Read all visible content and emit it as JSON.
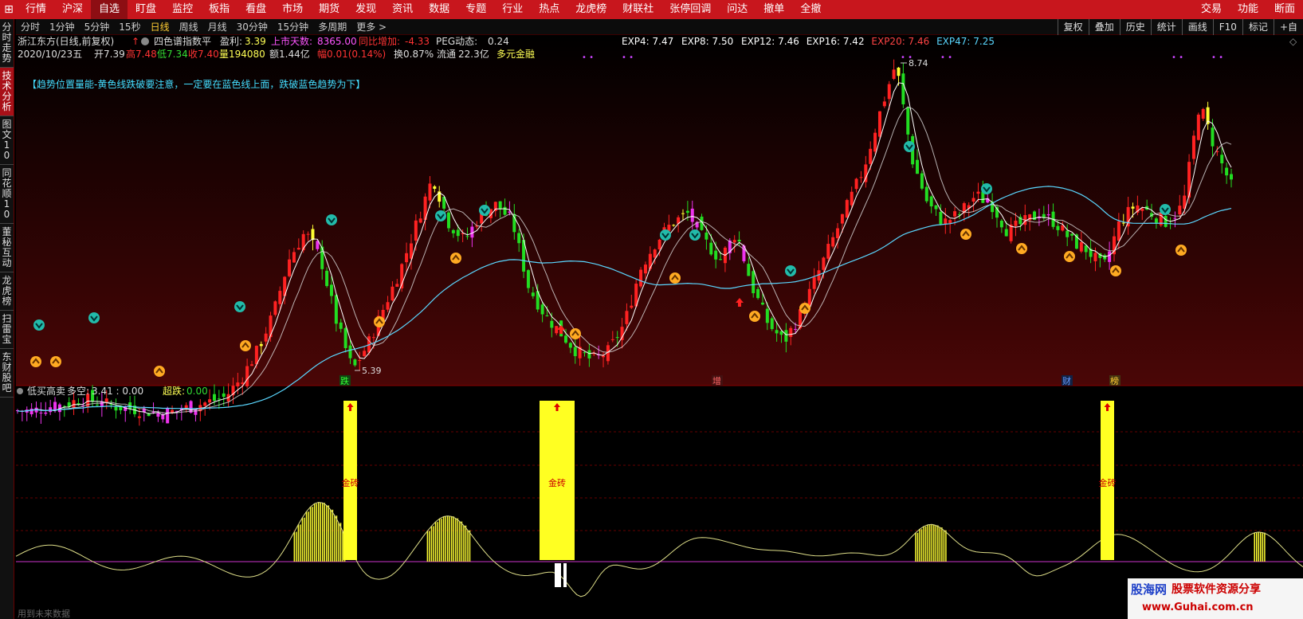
{
  "menu": {
    "items": [
      "行情",
      "沪深",
      "自选",
      "盯盘",
      "监控",
      "板指",
      "看盘",
      "市场",
      "期货",
      "发现",
      "资讯",
      "数据",
      "专题",
      "行业",
      "热点",
      "龙虎榜",
      "财联社",
      "张停回调",
      "问达",
      "撤单",
      "全撤"
    ],
    "right": [
      "交易",
      "功能",
      "断面"
    ]
  },
  "period": {
    "items": [
      "分时",
      "1分钟",
      "5分钟",
      "15秒",
      "日线",
      "周线",
      "月线",
      "30分钟",
      "15分钟",
      "多周期",
      "更多 >"
    ],
    "active": "日线",
    "tools": [
      "复权",
      "叠加",
      "历史",
      "统计",
      "画线",
      "F10",
      "标记",
      "+自"
    ]
  },
  "sidebar": [
    "分时走势",
    "技术分析",
    "图文10",
    "同花顺10",
    "董秘互动",
    "龙虎榜",
    "扫雷宝",
    "东财股吧"
  ],
  "header": {
    "stock": "浙江东方(日线,前复权)",
    "indicator": "四色谱指数平",
    "profit_label": "盈利:",
    "profit": "3.39",
    "days_label": "上市天数:",
    "days": "8365.00",
    "yoy_label": "同比增加:",
    "yoy": "-4.33",
    "peg_label": "PEG动态:",
    "peg": "0.24",
    "date": "2020/10/23五",
    "open_label": "开",
    "open": "7.39",
    "high_label": "高",
    "high": "7.48",
    "low_label": "低",
    "low": "7.34",
    "close_label": "收",
    "close": "7.40",
    "vol_label": "量",
    "vol": "194080",
    "amt_label": "额",
    "amt": "1.44亿",
    "chg_label": "幅",
    "chg": "0.01(0.14%)",
    "turn_label": "换",
    "turn": "0.87%",
    "float_label": "流通",
    "float": "22.3亿",
    "tag": "多元金融"
  },
  "exp": [
    {
      "name": "EXP4",
      "value": "7.47",
      "color": "#ffffff"
    },
    {
      "name": "EXP8",
      "value": "7.50",
      "color": "#ffffff"
    },
    {
      "name": "EXP12",
      "value": "7.46",
      "color": "#ffffff"
    },
    {
      "name": "EXP16",
      "value": "7.42",
      "color": "#ffffff"
    },
    {
      "name": "EXP20",
      "value": "7.46",
      "color": "#ff4444"
    },
    {
      "name": "EXP47",
      "value": "7.25",
      "color": "#5ad7ff"
    }
  ],
  "note": "【趋势位置量能-黄色线跌破要注意，一定要在蓝色线上面，跌破蓝色趋势为下】",
  "price_labels": {
    "max": "8.74",
    "min": "5.39"
  },
  "markers": [
    "跌",
    "增",
    "财",
    "榜"
  ],
  "sub": {
    "name": "低买高卖",
    "ls_label": "多空:",
    "ls": "3.41 : 0.00",
    "cd_label": "超跌:",
    "cd": "0.00",
    "bar_label": "金砖",
    "footer": "用到未来数据"
  },
  "watermark": {
    "logo": "股海网",
    "slogan": "股票软件资源分享",
    "url": "www.Guhai.com.cn"
  },
  "chart_data": {
    "type": "candlestick",
    "title": "浙江东方(日线,前复权)",
    "y_high": "8.74",
    "y_low": "5.39",
    "last_bar": {
      "date": "2020/10/23",
      "open": 7.39,
      "high": 7.48,
      "low": 7.34,
      "close": 7.4
    },
    "series": [
      {
        "name": "EXP4",
        "last": 7.47
      },
      {
        "name": "EXP8",
        "last": 7.5
      },
      {
        "name": "EXP12",
        "last": 7.46
      },
      {
        "name": "EXP16",
        "last": 7.42
      },
      {
        "name": "EXP20",
        "last": 7.46
      },
      {
        "name": "EXP47",
        "last": 7.25
      }
    ],
    "close_approx": [
      4.95,
      4.95,
      5.0,
      5.02,
      5.08,
      5.05,
      5.0,
      4.98,
      4.95,
      4.92,
      4.95,
      5.0,
      5.05,
      5.1,
      5.3,
      5.6,
      6.0,
      6.6,
      6.9,
      6.6,
      5.9,
      5.39,
      5.7,
      6.1,
      6.5,
      7.0,
      7.5,
      7.0,
      6.8,
      7.1,
      7.2,
      7.0,
      6.3,
      6.0,
      5.8,
      5.6,
      5.5,
      5.6,
      5.9,
      6.5,
      6.8,
      7.0,
      7.1,
      6.8,
      6.6,
      6.9,
      6.3,
      5.9,
      5.7,
      6.0,
      6.4,
      6.8,
      7.2,
      7.6,
      8.2,
      8.74,
      7.7,
      7.2,
      7.0,
      7.1,
      7.3,
      7.2,
      6.9,
      7.0,
      7.1,
      7.0,
      6.8,
      6.7,
      6.5,
      7.0,
      7.2,
      7.1,
      7.0,
      7.2,
      8.3,
      7.8,
      7.4
    ]
  }
}
